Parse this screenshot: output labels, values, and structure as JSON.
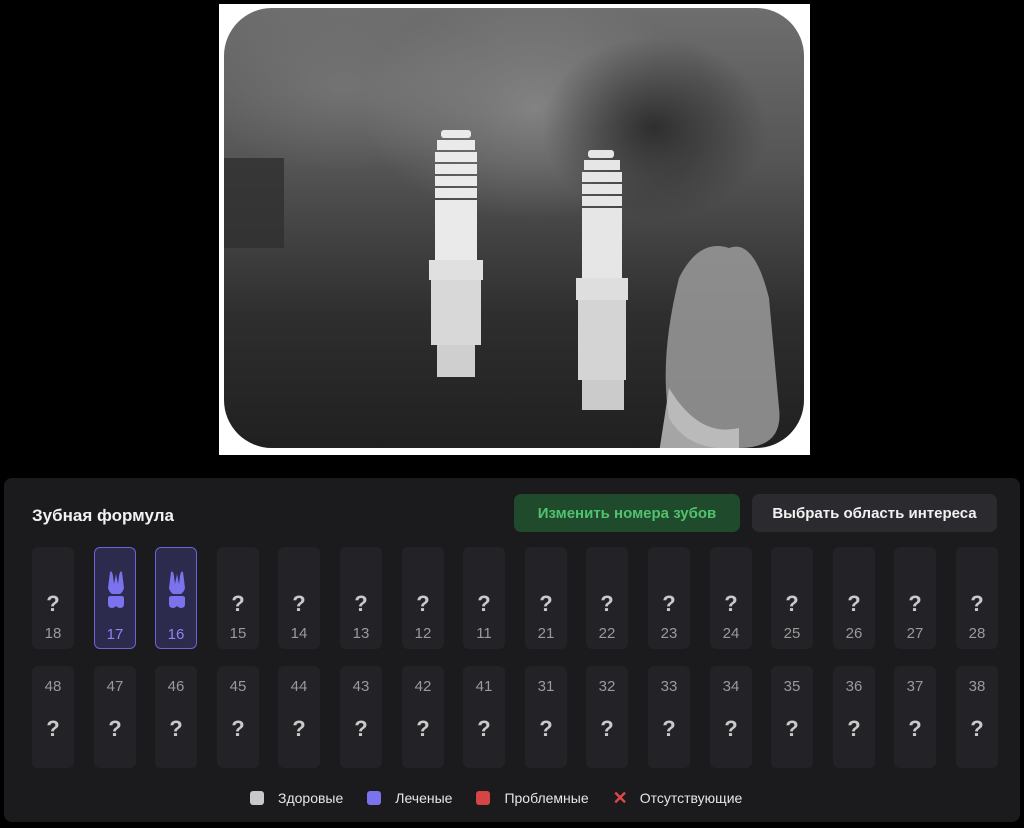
{
  "colors": {
    "treated": "#7b72ee",
    "healthy": "#c8c8c8",
    "problem": "#d64545",
    "missing": "#e04848",
    "accent_green": "#52c26e"
  },
  "panel": {
    "title": "Зубная формула",
    "change_numbers_button": "Изменить номера зубов",
    "select_region_button": "Выбрать область интереса"
  },
  "upper_teeth": [
    {
      "num": "18",
      "status": "unknown",
      "mark": "?"
    },
    {
      "num": "17",
      "status": "treated",
      "icon": "tooth-icon"
    },
    {
      "num": "16",
      "status": "treated",
      "icon": "tooth-icon"
    },
    {
      "num": "15",
      "status": "unknown",
      "mark": "?"
    },
    {
      "num": "14",
      "status": "unknown",
      "mark": "?"
    },
    {
      "num": "13",
      "status": "unknown",
      "mark": "?"
    },
    {
      "num": "12",
      "status": "unknown",
      "mark": "?"
    },
    {
      "num": "11",
      "status": "unknown",
      "mark": "?"
    },
    {
      "num": "21",
      "status": "unknown",
      "mark": "?"
    },
    {
      "num": "22",
      "status": "unknown",
      "mark": "?"
    },
    {
      "num": "23",
      "status": "unknown",
      "mark": "?"
    },
    {
      "num": "24",
      "status": "unknown",
      "mark": "?"
    },
    {
      "num": "25",
      "status": "unknown",
      "mark": "?"
    },
    {
      "num": "26",
      "status": "unknown",
      "mark": "?"
    },
    {
      "num": "27",
      "status": "unknown",
      "mark": "?"
    },
    {
      "num": "28",
      "status": "unknown",
      "mark": "?"
    }
  ],
  "lower_teeth": [
    {
      "num": "48",
      "mark": "?"
    },
    {
      "num": "47",
      "mark": "?"
    },
    {
      "num": "46",
      "mark": "?"
    },
    {
      "num": "45",
      "mark": "?"
    },
    {
      "num": "44",
      "mark": "?"
    },
    {
      "num": "43",
      "mark": "?"
    },
    {
      "num": "42",
      "mark": "?"
    },
    {
      "num": "41",
      "mark": "?"
    },
    {
      "num": "31",
      "mark": "?"
    },
    {
      "num": "32",
      "mark": "?"
    },
    {
      "num": "33",
      "mark": "?"
    },
    {
      "num": "34",
      "mark": "?"
    },
    {
      "num": "35",
      "mark": "?"
    },
    {
      "num": "36",
      "mark": "?"
    },
    {
      "num": "37",
      "mark": "?"
    },
    {
      "num": "38",
      "mark": "?"
    }
  ],
  "legend": {
    "healthy": "Здоровые",
    "treated": "Леченые",
    "problem": "Проблемные",
    "missing": "Отсутствующие",
    "missing_mark": "✕"
  }
}
